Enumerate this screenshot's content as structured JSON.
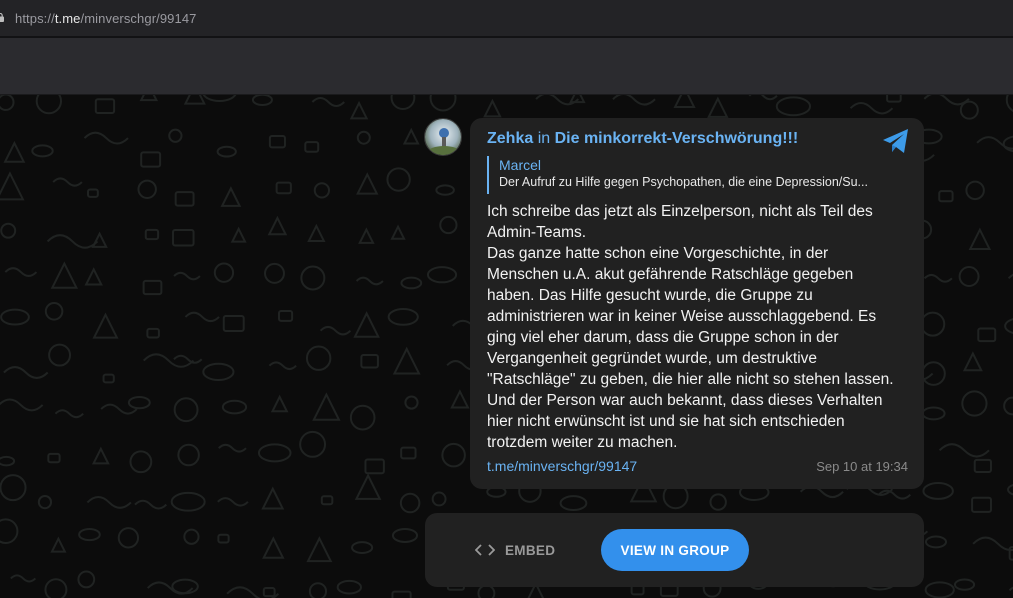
{
  "browser": {
    "url_scheme": "https://",
    "url_host": "t.me",
    "url_path": "/minverschgr/99147"
  },
  "post": {
    "author": "Zehka",
    "in_word": "in",
    "group": "Die minkorrekt-Verschwörung!!!",
    "reply": {
      "name": "Marcel",
      "text": "Der Aufruf zu Hilfe gegen Psychopathen, die eine Depression/Su..."
    },
    "lines": [
      "Ich schreibe das jetzt als Einzelperson, nicht als Teil des",
      "Admin-Teams.",
      "Das ganze hatte schon eine Vorgeschichte, in der",
      "Menschen u.A. akut gefährende Ratschläge gegeben",
      "haben. Das Hilfe gesucht wurde, die Gruppe zu",
      "administrieren war in keiner Weise ausschlaggebend. Es",
      "ging viel eher darum, dass die Gruppe schon in der",
      "Vergangenheit gegründet wurde, um destruktive",
      "\"Ratschläge\" zu geben, die hier alle nicht so stehen lassen.",
      "Und der Person war auch bekannt, dass dieses Verhalten",
      "hier nicht erwünscht ist und sie hat sich entschieden",
      "trotzdem weiter zu machen."
    ],
    "link": "t.me/minverschgr/99147",
    "time": "Sep 10 at 19:34"
  },
  "actions": {
    "embed_label": "EMBED",
    "view_label": "VIEW IN GROUP"
  },
  "icons": {
    "lock": "lock-icon",
    "telegram": "telegram-logo-icon",
    "embed": "code-brackets-icon"
  },
  "colors": {
    "accent": "#6ab3f3",
    "button": "#3390ec",
    "bubble": "#212121",
    "background": "#0c0c0c"
  }
}
